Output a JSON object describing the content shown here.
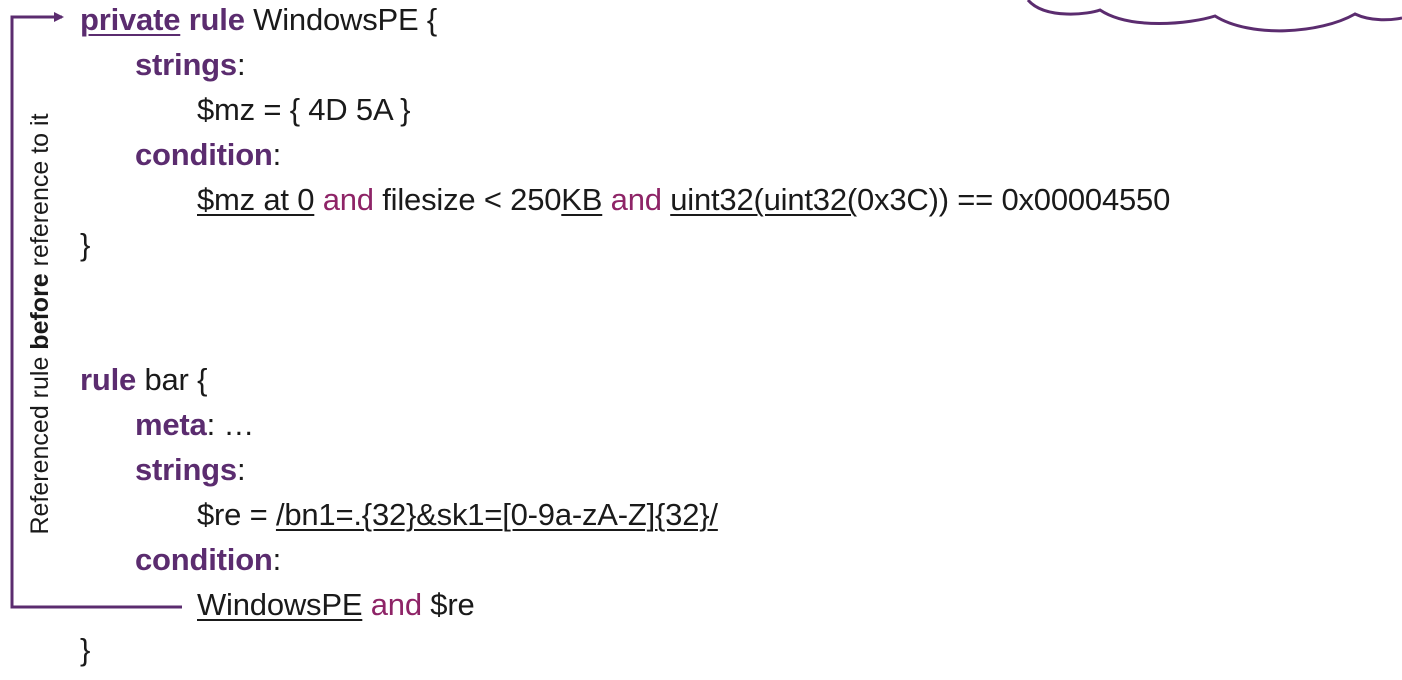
{
  "annotation": {
    "prefix": "Referenced rule ",
    "emphasis": "before",
    "suffix": " reference to it"
  },
  "rule1": {
    "private_kw": "private",
    "rule_kw": "rule",
    "name_open": " WindowsPE {",
    "strings_kw": "strings",
    "colon": ":",
    "mz_line": "$mz = { 4D 5A }",
    "condition_kw": "condition",
    "cond_mz_at": "$mz at 0",
    "and1": "and",
    "filesize": "filesize < 250",
    "kb": "KB",
    "and2": "and",
    "uint32": "uint32(uint32(",
    "cond_tail": "0x3C)) == 0x00004550",
    "close": "}"
  },
  "rule2": {
    "rule_kw": "rule",
    "name_open": " bar {",
    "meta_kw": "meta",
    "meta_rest": ": …",
    "strings_kw": "strings",
    "colon": ":",
    "re_prefix": "$re = ",
    "re_value": "/bn1=.{32}&sk1=[0-9a-zA-Z]{32}/",
    "condition_kw": "condition",
    "cond_ref": "WindowsPE",
    "and": "and",
    "cond_re": "$re",
    "close": "}"
  },
  "colors": {
    "keyword": "#5b2c6f",
    "operator": "#8e2467",
    "arrow": "#5b2c6f"
  }
}
